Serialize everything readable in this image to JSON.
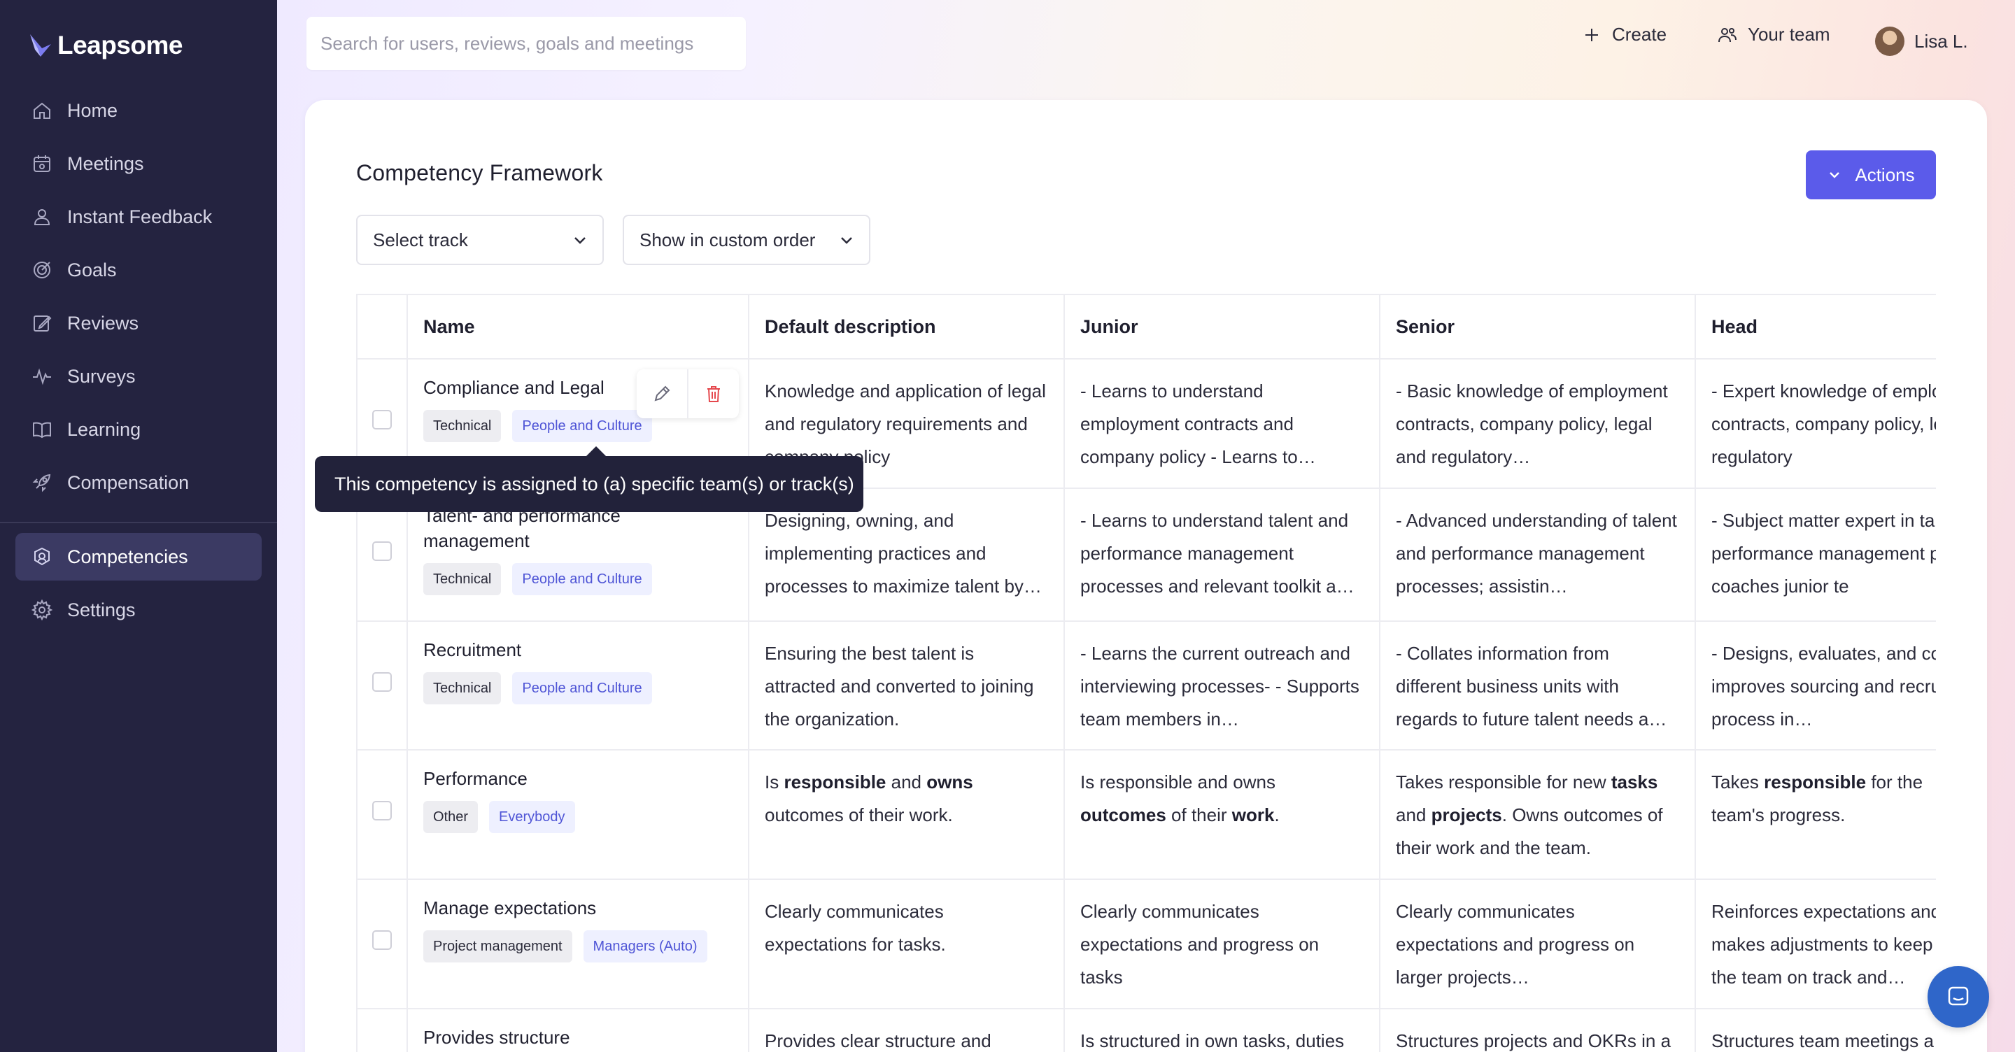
{
  "brand": {
    "name": "Leapsome"
  },
  "sidebar": {
    "items": [
      {
        "label": "Home",
        "icon": "home-icon"
      },
      {
        "label": "Meetings",
        "icon": "calendar-icon"
      },
      {
        "label": "Instant Feedback",
        "icon": "feedback-icon"
      },
      {
        "label": "Goals",
        "icon": "target-icon"
      },
      {
        "label": "Reviews",
        "icon": "edit-icon"
      },
      {
        "label": "Surveys",
        "icon": "pulse-icon"
      },
      {
        "label": "Learning",
        "icon": "book-icon"
      },
      {
        "label": "Compensation",
        "icon": "rocket-icon"
      }
    ],
    "secondary": [
      {
        "label": "Competencies",
        "icon": "competencies-icon",
        "active": true
      },
      {
        "label": "Settings",
        "icon": "gear-icon"
      }
    ]
  },
  "topbar": {
    "search_placeholder": "Search for users, reviews, goals and meetings",
    "create_label": "Create",
    "team_label": "Your team",
    "user_name": "Lisa L."
  },
  "page": {
    "title": "Competency Framework",
    "actions_label": "Actions",
    "track_select": "Select track",
    "order_select": "Show in custom order"
  },
  "table": {
    "columns": [
      "Name",
      "Default description",
      "Junior",
      "Senior",
      "Head"
    ],
    "rows": [
      {
        "name": "Compliance and Legal",
        "tags": [
          "Technical",
          "People and Culture"
        ],
        "default": "Knowledge and application of legal and regulatory requirements and company policy",
        "junior": "- Learns to understand employment contracts and company policy - Learns to…",
        "senior": "- Basic knowledge of employment contracts, company policy, legal and regulatory…",
        "head": "- Expert knowledge of employment contracts, company policy, legal and regulatory"
      },
      {
        "name": "Talent- and performance management",
        "tags": [
          "Technical",
          "People and Culture"
        ],
        "default": "Designing, owning, and implementing practices and processes to maximize talent by…",
        "junior": "- Learns to understand talent and performance management processes and relevant toolkit a…",
        "senior": "- Advanced understanding of talent and performance management processes; assistin…",
        "head": "- Subject matter expert in talent and performance management processes coaches junior te"
      },
      {
        "name": "Recruitment",
        "tags": [
          "Technical",
          "People and Culture"
        ],
        "default": "Ensuring the best talent is attracted and converted to joining the organization.",
        "junior": "- Learns the current outreach and interviewing processes- - Supports team members in…",
        "senior": "- Collates information from different business units with regards to future talent needs a…",
        "head": "- Designs, evaluates, and continuously improves sourcing and recruitment process in…"
      },
      {
        "name": "Performance",
        "tags": [
          "Other",
          "Everybody"
        ],
        "default_parts": [
          "Is ",
          "responsible",
          " and ",
          "owns",
          " outcomes of their work."
        ],
        "junior_parts": [
          "Is responsible and owns ",
          "outcomes",
          " of their ",
          "work",
          "."
        ],
        "senior_parts": [
          "Takes responsible for new ",
          "tasks",
          " and ",
          "projects",
          ". Owns outcomes of their work and the team."
        ],
        "head_parts": [
          "Takes ",
          "responsible",
          " for the team's progress."
        ]
      },
      {
        "name": "Manage expectations",
        "tags": [
          "Project management",
          "Managers (Auto)"
        ],
        "default": "Clearly communicates expectations for tasks.",
        "junior": "Clearly communicates expectations and progress on tasks",
        "senior": "Clearly communicates expectations and progress on larger projects…",
        "head": "Reinforces expectations and makes adjustments to keep the team on track and aligned w"
      },
      {
        "name": "Provides structure",
        "tags": [],
        "default": "Provides clear structure and",
        "junior": "Is structured in own tasks, duties",
        "senior": "Structures projects and OKRs in a",
        "head": "Structures team meetings a"
      }
    ]
  },
  "tooltip": {
    "text": "This competency is assigned to (a) specific team(s) or track(s)"
  },
  "colors": {
    "sidebar": "#242340",
    "accent": "#5b5bea",
    "chat": "#2f66c9"
  }
}
